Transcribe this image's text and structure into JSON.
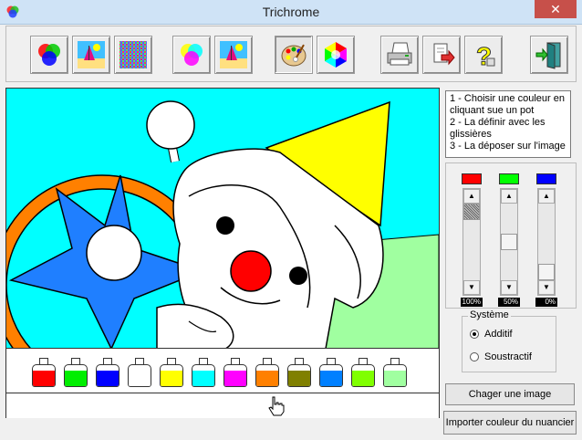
{
  "window": {
    "title": "Trichrome",
    "close_label": "✕"
  },
  "toolbar": {
    "buttons": [
      {
        "name": "rgb-circles-icon"
      },
      {
        "name": "beach-image-icon"
      },
      {
        "name": "pattern-grid-icon"
      },
      {
        "name": "cmy-circles-icon"
      },
      {
        "name": "beach-image-2-icon"
      },
      {
        "name": "palette-icon"
      },
      {
        "name": "hexagon-color-icon"
      },
      {
        "name": "printer-icon"
      },
      {
        "name": "export-icon"
      },
      {
        "name": "help-icon"
      },
      {
        "name": "exit-door-icon"
      }
    ]
  },
  "instructions": {
    "line1": "1 - Choisir une couleur en cliquant sue un pot",
    "line2": "2 - La définir avec les glissières",
    "line3": "3 - La déposer sur l'image"
  },
  "sliders": [
    {
      "color": "#ff0000",
      "percent_label": "100%",
      "value": 100
    },
    {
      "color": "#00ff00",
      "percent_label": "50%",
      "value": 50
    },
    {
      "color": "#0000ff",
      "percent_label": "0%",
      "value": 0
    }
  ],
  "systeme": {
    "legend": "Système",
    "additif": "Additif",
    "soustractif": "Soustractif",
    "selected": "additif"
  },
  "buttons": {
    "charger": "Chager une image",
    "importer": "Importer couleur du nuancier"
  },
  "pots": [
    "#ff0000",
    "#00ee00",
    "#0000ff",
    "#ffffff",
    "#ffff00",
    "#00ffff",
    "#ff00ff",
    "#ff8000",
    "#808000",
    "#0080ff",
    "#80ff00",
    "#a0ffa0"
  ],
  "colors": {
    "sky": "#00ffff",
    "grass": "#a0ffa0",
    "hat": "#ffff00",
    "star": "#1f7fff",
    "wheel": "#ff8000",
    "nose": "#ff0000"
  }
}
